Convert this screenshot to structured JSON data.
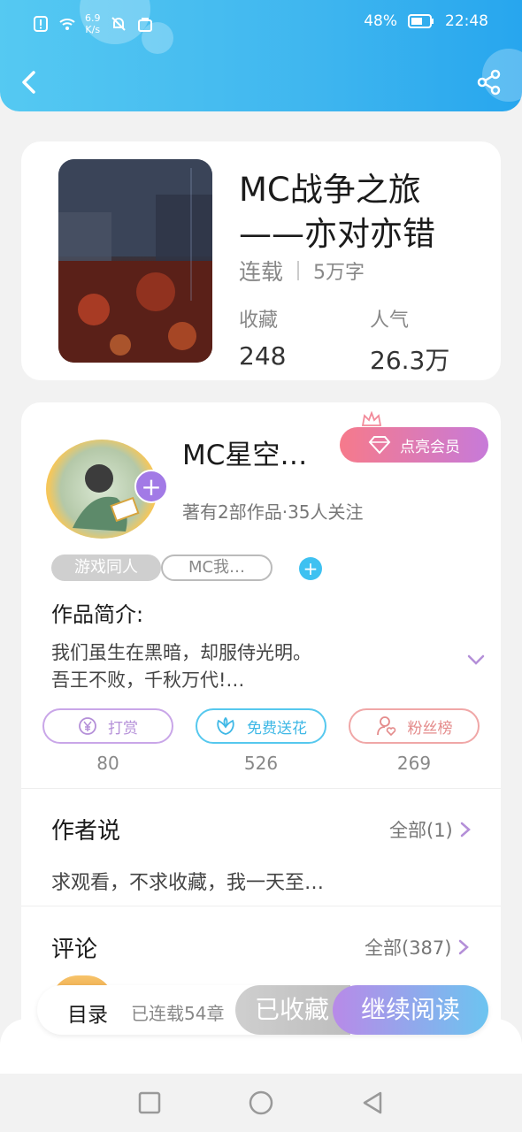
{
  "status": {
    "speed": "6.9\nK/s",
    "speed_top": "6.9",
    "speed_bottom": "K/s",
    "battery": "48%",
    "time": "22:48"
  },
  "book": {
    "title": "MC战争之旅——亦对亦错",
    "title_line1": "MC战争之旅",
    "title_line2": "——亦对亦错",
    "status": "连载",
    "words": "5万字",
    "favorites_label": "收藏",
    "favorites_value": "248",
    "popularity_label": "人气",
    "popularity_value": "26.3万"
  },
  "author": {
    "name": "MC星空…",
    "vip_label": "点亮会员",
    "stats": "著有2部作品·35人关注",
    "tags": [
      "游戏同人",
      "MC我…"
    ]
  },
  "intro": {
    "heading": "作品简介:",
    "line1": "我们虽生在黑暗，却服侍光明。",
    "line2": "吾王不败，千秋万代!…"
  },
  "actions": [
    {
      "label": "打赏",
      "count": "80",
      "icon": "yen-coin-icon"
    },
    {
      "label": "免费送花",
      "count": "526",
      "icon": "flower-icon"
    },
    {
      "label": "粉丝榜",
      "count": "269",
      "icon": "user-heart-icon"
    }
  ],
  "author_notes": {
    "heading": "作者说",
    "more": "全部(1)",
    "preview": "求观看，不求收藏，我一天至…"
  },
  "comments": {
    "heading": "评论",
    "more": "全部(387)"
  },
  "bottom_bar": {
    "catalog": "目录",
    "updated": "已连载54章",
    "collected": "已收藏",
    "continue_reading": "继续阅读"
  },
  "colors": {
    "header_start": "#55c9f2",
    "header_end": "#27a6ee",
    "accent_purple": "#a27ae6",
    "accent_blue": "#3ec1f1"
  }
}
